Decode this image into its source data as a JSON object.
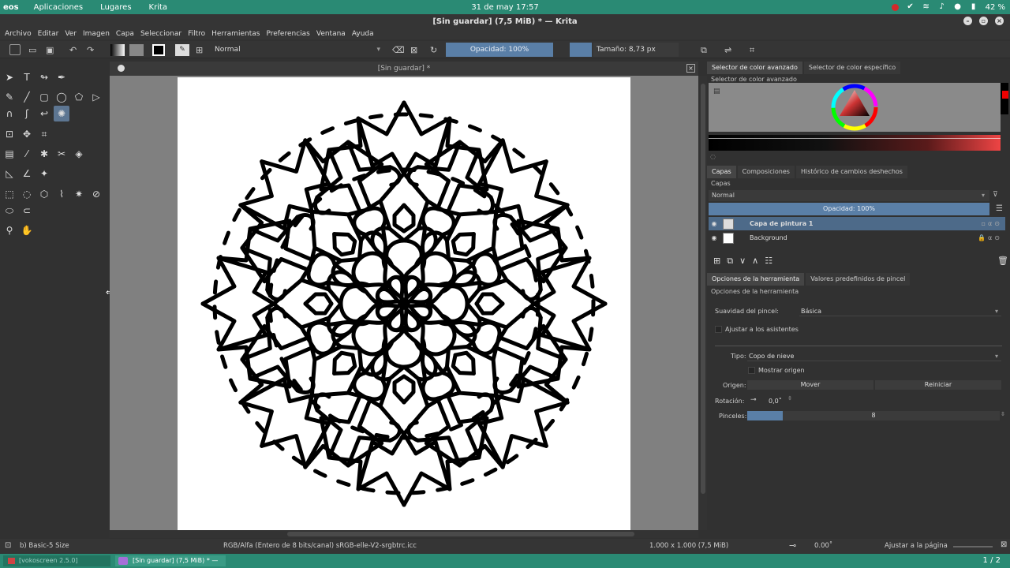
{
  "system_bar": {
    "logo": "eos",
    "menu": [
      "Aplicaciones",
      "Lugares",
      "Krita"
    ],
    "clock": "31 de may  17:57",
    "battery": "42 %",
    "accent": "#2a8a74"
  },
  "window": {
    "title": "[Sin guardar]  (7,5 MiB)  * — Krita"
  },
  "menubar": [
    "Archivo",
    "Editar",
    "Ver",
    "Imagen",
    "Capa",
    "Seleccionar",
    "Filtro",
    "Herramientas",
    "Preferencias",
    "Ventana",
    "Ayuda"
  ],
  "toolbar": {
    "blend_mode": "Normal",
    "opacity": "Opacidad: 100%",
    "size": "Tamaño: 8,73 px"
  },
  "document": {
    "tab_title": "[Sin guardar]  *"
  },
  "docker": {
    "color_tabs": [
      "Selector de color avanzado",
      "Selector de color específico"
    ],
    "color_header": "Selector de color avanzado",
    "layer_tabs": [
      "Capas",
      "Composiciones",
      "Histórico de cambios deshechos"
    ],
    "layers_header": "Capas",
    "layer_blend": "Normal",
    "layer_opacity": "Opacidad:  100%",
    "layers": [
      {
        "name": "Capa de pintura 1",
        "selected": true
      },
      {
        "name": "Background",
        "selected": false
      }
    ],
    "options_tabs": [
      "Opciones de la herramienta",
      "Valores predefinidos de pincel"
    ],
    "options_header": "Opciones de la herramienta",
    "smoothing_label": "Suavidad del pincel:",
    "smoothing_value": "Básica",
    "assistants_label": "Ajustar a los asistentes",
    "type_label": "Tipo:",
    "type_value": "Copo de nieve",
    "show_origin_label": "Mostrar origen",
    "origin_label": "Origen:",
    "move_button": "Mover",
    "reset_button": "Reiniciar",
    "rotation_label": "Rotación:",
    "rotation_value": "0,0˚",
    "brushes_label": "Pinceles:",
    "brushes_value": "8",
    "brushes_fraction": 0.14
  },
  "statusbar": {
    "brush_preset": "b) Basic-5 Size",
    "color_profile": "RGB/Alfa (Entero de 8 bits/canal)  sRGB-elle-V2-srgbtrc.icc",
    "dimensions": "1.000 x 1.000 (7,5 MiB)",
    "rotation": "0.00˚",
    "zoom_mode": "Ajustar a la página"
  },
  "taskbar": {
    "task1": "[vokoscreen 2.5.0]",
    "task2": "[Sin guardar]  (7,5 MiB) * — Krita",
    "pager": "1 / 2"
  }
}
